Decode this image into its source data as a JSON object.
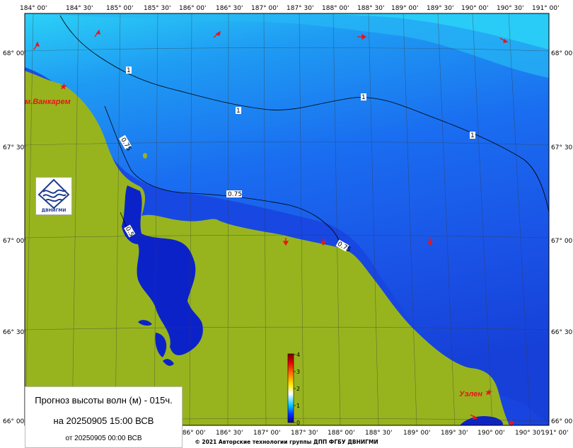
{
  "map": {
    "lon_labels": [
      "184° 00'",
      "184° 30'",
      "185° 00'",
      "185° 30'",
      "186° 00'",
      "186° 30'",
      "187° 00'",
      "187° 30'",
      "188° 00'",
      "188° 30'",
      "189° 00'",
      "189° 30'",
      "190° 00'",
      "190° 30'",
      "191° 00'"
    ],
    "lat_labels": [
      "68° 00'",
      "67° 30'",
      "67° 00'",
      "66° 30'",
      "66° 00'"
    ],
    "contour_labels": [
      "1",
      "1",
      "1",
      "1",
      "0.75",
      "0.75",
      "0.5",
      "0.75"
    ],
    "places": {
      "vankarem": "м.Ванкарем",
      "uelen": "Уэлен"
    },
    "colors": {
      "land": "#97b41e",
      "deep_blue": "#0c22c9",
      "mid_blue": "#1e58ef",
      "light_blue": "#26c8f4",
      "arrow": "#e8151a"
    },
    "wave_height_range_m": [
      0,
      4
    ]
  },
  "colorbar": {
    "ticks": [
      "4",
      "3",
      "2",
      "1",
      "0"
    ]
  },
  "info": {
    "title": "Прогноз высоты волн (м) - 015ч.",
    "valid": "на 20250905 15:00 ВСВ",
    "issued": "от 20250905 00:00 ВСВ"
  },
  "logo": {
    "text": "ДВНИГМИ"
  },
  "footer": {
    "copyright": "© 2021 Авторские технологии группы ДПП ФГБУ ДВНИГМИ"
  }
}
